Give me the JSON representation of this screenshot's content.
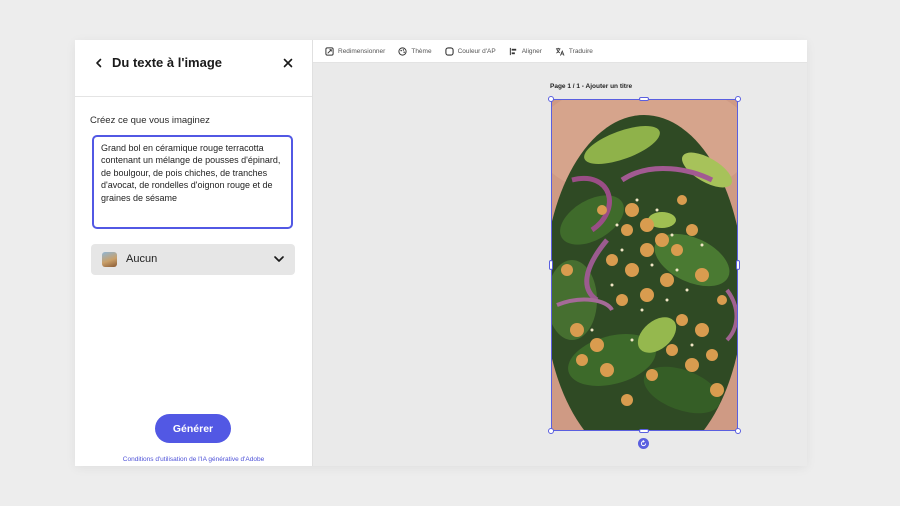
{
  "panel": {
    "title": "Du texte à l'image",
    "prompt_label": "Créez ce que vous imaginez",
    "prompt_value": "Grand bol en céramique rouge terracotta contenant un mélange de pousses d'épinard, de boulgour, de pois chiches, de tranches d'avocat, de rondelles d'oignon rouge et de graines de sésame",
    "style_select": {
      "value": "Aucun",
      "thumb_icon": "style-thumbnail"
    },
    "generate_label": "Générer",
    "terms_link": "Conditions d'utilisation de l'IA générative d'Adobe"
  },
  "toolbar": {
    "items": [
      {
        "label": "Redimensionner",
        "icon": "resize-icon"
      },
      {
        "label": "Thème",
        "icon": "theme-icon"
      },
      {
        "label": "Couleur d'AP",
        "icon": "background-color-icon"
      },
      {
        "label": "Aligner",
        "icon": "align-icon"
      },
      {
        "label": "Traduire",
        "icon": "translate-icon"
      }
    ]
  },
  "canvas": {
    "page_label": "Page 1 / 1 - Ajouter un titre",
    "image_subject": "salad bowl photo"
  },
  "colors": {
    "accent": "#5258e4",
    "panel_bg": "#ffffff",
    "canvas_bg": "#eaeaea"
  }
}
